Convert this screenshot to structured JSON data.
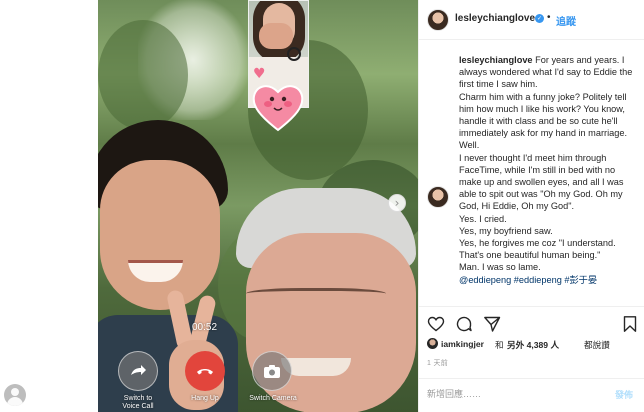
{
  "call": {
    "timer": "00:52",
    "switch_label": "Switch to\nVoice Call",
    "hangup_label": "Hang Up",
    "camera_label": "Switch Camera"
  },
  "post": {
    "username": "lesleychianglove",
    "dot": "•",
    "follow_label": "追蹤",
    "caption_username": "lesleychianglove",
    "caption_lines": [
      "For years and years. I always wondered what I'd say to Eddie the first time I saw him.",
      "Charm him with a funny joke? Politely tell him how much I like his work? You know, handle it with class and be so cute he'll immediately ask for my hand in marriage.",
      "Well.",
      "I never thought I'd meet him through FaceTime, while I'm still in bed with no make up and swollen eyes, and all I was able to spit out was \"Oh my God. Oh my God, Hi Eddie, Oh my God\".",
      "Yes. I cried.",
      "Yes, my boyfriend saw.",
      "Yes, he forgives me coz \"I understand. That's one beautiful human being.\"",
      "Man. I was so lame."
    ],
    "hashtags": "@eddiepeng #eddiepeng #彭于晏",
    "liked_by_user": "iamkingjer",
    "liked_and": "和",
    "liked_others": "另外 4,389 人",
    "liked_suffix": "都說讚",
    "time_ago": "1 天前",
    "comment_placeholder": "新增回應……",
    "post_label": "發佈"
  },
  "icons": {
    "like": "heart-outline-icon",
    "comment": "comment-bubble-icon",
    "share": "paper-plane-icon",
    "save": "bookmark-icon",
    "next": "chevron-right-icon"
  },
  "colors": {
    "link_blue": "#3897f0",
    "hangup_red": "#e2453c",
    "muted_gray": "#999999"
  }
}
